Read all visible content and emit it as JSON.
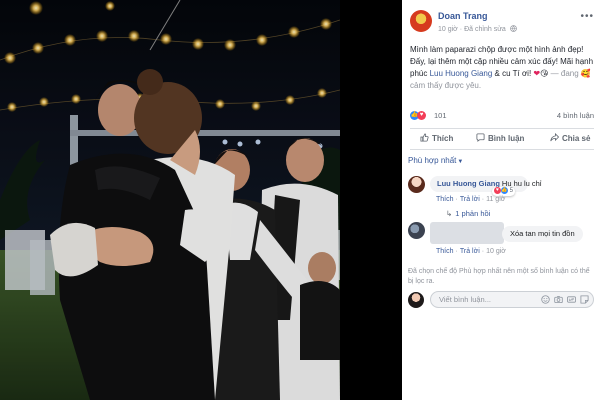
{
  "post": {
    "author": "Doan Trang",
    "time": "10 giờ",
    "privacy": "Đã chỉnh sửa",
    "text_part1": "Mình làm paparazi chộp được một hình ảnh đẹp! Đấy, lại thêm một cặp nhiều cảm xúc đấy! Mãi hạnh phúc ",
    "mention1": "Luu Huong Giang",
    "text_amp": " & cu Tí ơi! ",
    "text_part2": " — đang ",
    "feeling": "cảm thấy được yêu.",
    "reaction_count": "101",
    "share_count": "4 bình luận",
    "actions": {
      "like": "Thích",
      "comment": "Bình luận",
      "share": "Chia sẻ"
    }
  },
  "comments": {
    "sort_label": "Phù hợp nhất",
    "items": [
      {
        "author": "Luu Huong Giang",
        "text": "Hu hu lu chỉ",
        "like": "Thích",
        "reply": "Trả lời",
        "time": "11 giờ",
        "reaction_count": "5",
        "replies": "1 phản hồi"
      },
      {
        "text": "Xóa tan mọi tin đồn",
        "like": "Thích",
        "reply": "Trả lời",
        "time": "10 giờ"
      }
    ],
    "notice": "Đã chọn chế độ Phù hợp nhất nên một số bình luận có thể bị lọc ra.",
    "write_placeholder": "Viết bình luận..."
  },
  "icons": {
    "privacy": "globe-icon",
    "more": "more-icon",
    "like": "thumbs-up-icon",
    "comment": "comment-icon",
    "share": "share-icon",
    "emoji": "emoji-icon",
    "camera": "camera-icon",
    "gif": "gif-icon",
    "sticker": "sticker-icon"
  },
  "colors": {
    "link": "#385898",
    "like_blue": "#2d88ff",
    "love_red": "#f33e58",
    "meta_gray": "#90949c"
  }
}
